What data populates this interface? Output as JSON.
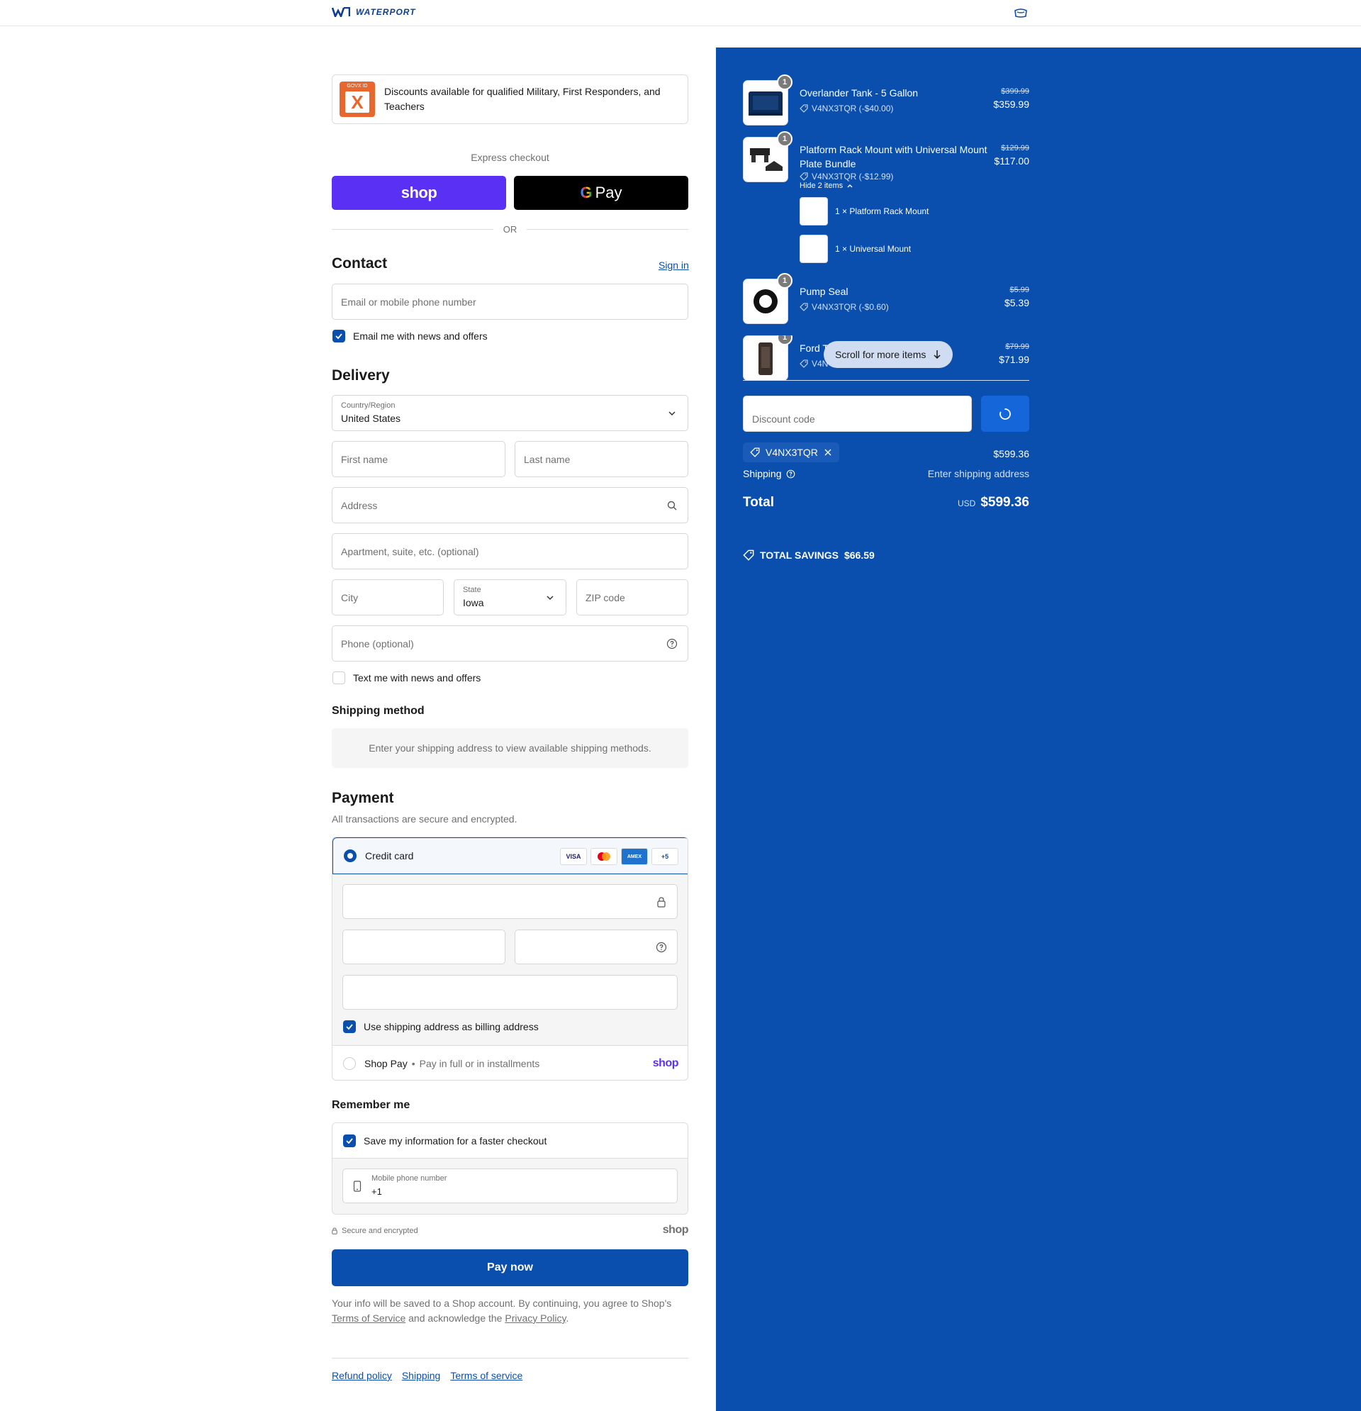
{
  "header": {
    "brand": "WATERPORT"
  },
  "promo": {
    "text": "Discounts available for qualified Military, First Responders, and Teachers",
    "logo_tag": "GOVX ID",
    "logo_mark": "X"
  },
  "express": {
    "title": "Express checkout",
    "shop_label": "shop",
    "gpay_label": "Pay",
    "gpay_g": "G",
    "or": "OR"
  },
  "contact": {
    "title": "Contact",
    "signin": "Sign in",
    "email_placeholder": "Email or mobile phone number",
    "news_label": "Email me with news and offers",
    "news_checked": true
  },
  "delivery": {
    "title": "Delivery",
    "country_label": "Country/Region",
    "country_value": "United States",
    "first_name": "First name",
    "last_name": "Last name",
    "address": "Address",
    "apartment": "Apartment, suite, etc. (optional)",
    "city": "City",
    "state_label": "State",
    "state_value": "Iowa",
    "zip": "ZIP code",
    "phone": "Phone (optional)",
    "text_label": "Text me with news and offers",
    "text_checked": false
  },
  "shipping_method": {
    "title": "Shipping method",
    "message": "Enter your shipping address to view available shipping methods."
  },
  "payment": {
    "title": "Payment",
    "note": "All transactions are secure and encrypted.",
    "credit_label": "Credit card",
    "cards": [
      "VISA",
      "MC",
      "AMEX",
      "+5"
    ],
    "billing_label": "Use shipping address as billing address",
    "billing_checked": true,
    "shoppay_label": "Shop Pay",
    "shoppay_sub": "Pay in full or in installments",
    "shoppay_brand": "shop"
  },
  "remember": {
    "title": "Remember me",
    "save_label": "Save my information for a faster checkout",
    "save_checked": true,
    "phone_label": "Mobile phone number",
    "phone_value": "+1"
  },
  "secure": {
    "text": "Secure and encrypted",
    "brand": "shop"
  },
  "paynow": "Pay now",
  "legal": {
    "pre": "Your info will be saved to a Shop account. By continuing, you agree to Shop's ",
    "tos": "Terms of Service",
    "mid": " and acknowledge the ",
    "privacy": "Privacy Policy",
    "post": "."
  },
  "footer": {
    "links": [
      "Refund policy",
      "Shipping",
      "Terms of service"
    ]
  },
  "summary": {
    "items": [
      {
        "name": "Overlander Tank - 5 Gallon",
        "qty": "1",
        "discount": "V4NX3TQR (-$40.00)",
        "original": "$399.99",
        "price": "$359.99"
      },
      {
        "name": "Platform Rack Mount with Universal Mount Plate Bundle",
        "qty": "1",
        "discount": "V4NX3TQR (-$12.99)",
        "original": "$129.99",
        "price": "$117.00",
        "toggle": "Hide 2 items",
        "sub_items": [
          {
            "label": "1 × Platform Rack Mount"
          },
          {
            "label": "1 × Universal Mount"
          }
        ]
      },
      {
        "name": "Pump Seal",
        "qty": "1",
        "discount": "V4NX3TQR (-$0.60)",
        "original": "$5.99",
        "price": "$5.39"
      },
      {
        "name": "Ford T",
        "qty": "1",
        "discount": "V4N",
        "original": "$79.99",
        "price": "$71.99"
      }
    ],
    "scroll_hint": "Scroll for more items",
    "discount_placeholder": "Discount code",
    "code": "V4NX3TQR",
    "subtotal": "$599.36",
    "shipping_label": "Shipping",
    "shipping_value": "Enter shipping address",
    "total_label": "Total",
    "currency": "USD",
    "total": "$599.36",
    "savings_label": "TOTAL SAVINGS",
    "savings_value": "$66.59"
  },
  "colors": {
    "accent": "#0a4fad",
    "shop_purple": "#5a31f4",
    "summary_bg": "#0a4fad"
  }
}
